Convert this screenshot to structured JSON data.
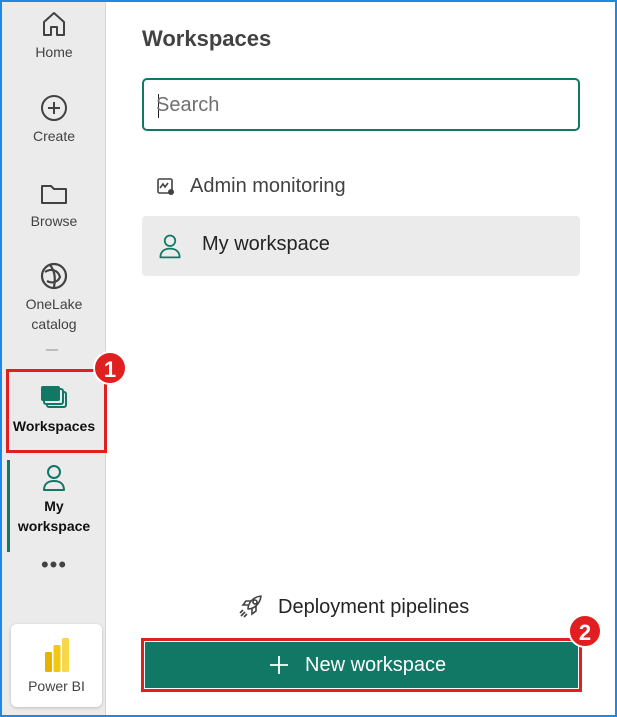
{
  "rail": {
    "items": [
      {
        "label": "Home",
        "icon": "home-icon"
      },
      {
        "label": "Create",
        "icon": "create-icon"
      },
      {
        "label": "Browse",
        "icon": "folder-icon"
      },
      {
        "label_line1": "OneLake",
        "label_line2": "catalog",
        "icon": "onelake-icon"
      },
      {
        "label": "Workspaces",
        "icon": "workspaces-icon"
      },
      {
        "label_line1": "My",
        "label_line2": "workspace",
        "icon": "person-icon"
      }
    ],
    "more": "•••",
    "app": {
      "label": "Power BI",
      "icon": "powerbi-icon"
    }
  },
  "panel": {
    "title": "Workspaces",
    "search": {
      "value": "",
      "placeholder": "Search"
    },
    "workspaces": [
      {
        "label": "Admin monitoring",
        "icon": "monitoring-icon"
      },
      {
        "label": "My workspace",
        "icon": "person-icon",
        "selected": true
      }
    ],
    "deployment": {
      "label": "Deployment pipelines",
      "icon": "rocket-icon"
    },
    "new_workspace": {
      "label": "New workspace",
      "icon": "plus-icon"
    }
  },
  "callouts": {
    "one": "1",
    "two": "2"
  },
  "colors": {
    "accent": "#117865",
    "callout": "#e02020",
    "rail_bg": "#ebebeb",
    "frame": "#1e88e5"
  }
}
